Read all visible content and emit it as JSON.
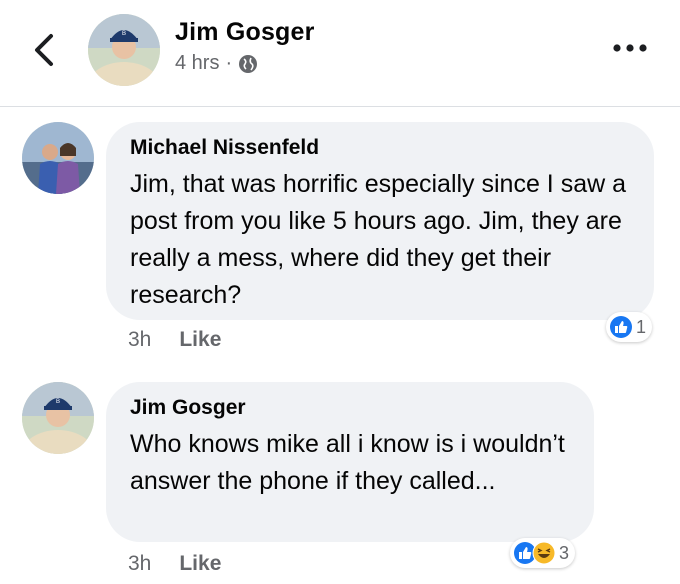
{
  "header": {
    "name": "Jim Gosger",
    "time": "4 hrs",
    "separator": "·",
    "privacy_icon": "globe-icon",
    "back_icon": "chevron-left-icon",
    "more_icon": "more-dots-icon"
  },
  "comments": [
    {
      "author": "Michael Nissenfeld",
      "text": "Jim, that was horrific especially since I saw a post from you  like 5 hours ago. Jim, they are really a mess, where did they get their research?",
      "time": "3h",
      "like_label": "Like",
      "reactions": [
        "like"
      ],
      "reaction_count": "1"
    },
    {
      "author": "Jim Gosger",
      "text": "Who knows mike all i know is i wouldn’t answer the phone if they called...",
      "time": "3h",
      "like_label": "Like",
      "reactions": [
        "like",
        "haha"
      ],
      "reaction_count": "3"
    }
  ],
  "colors": {
    "like_blue": "#1877f2",
    "bubble_bg": "#f0f2f5",
    "meta_gray": "#65676b"
  }
}
